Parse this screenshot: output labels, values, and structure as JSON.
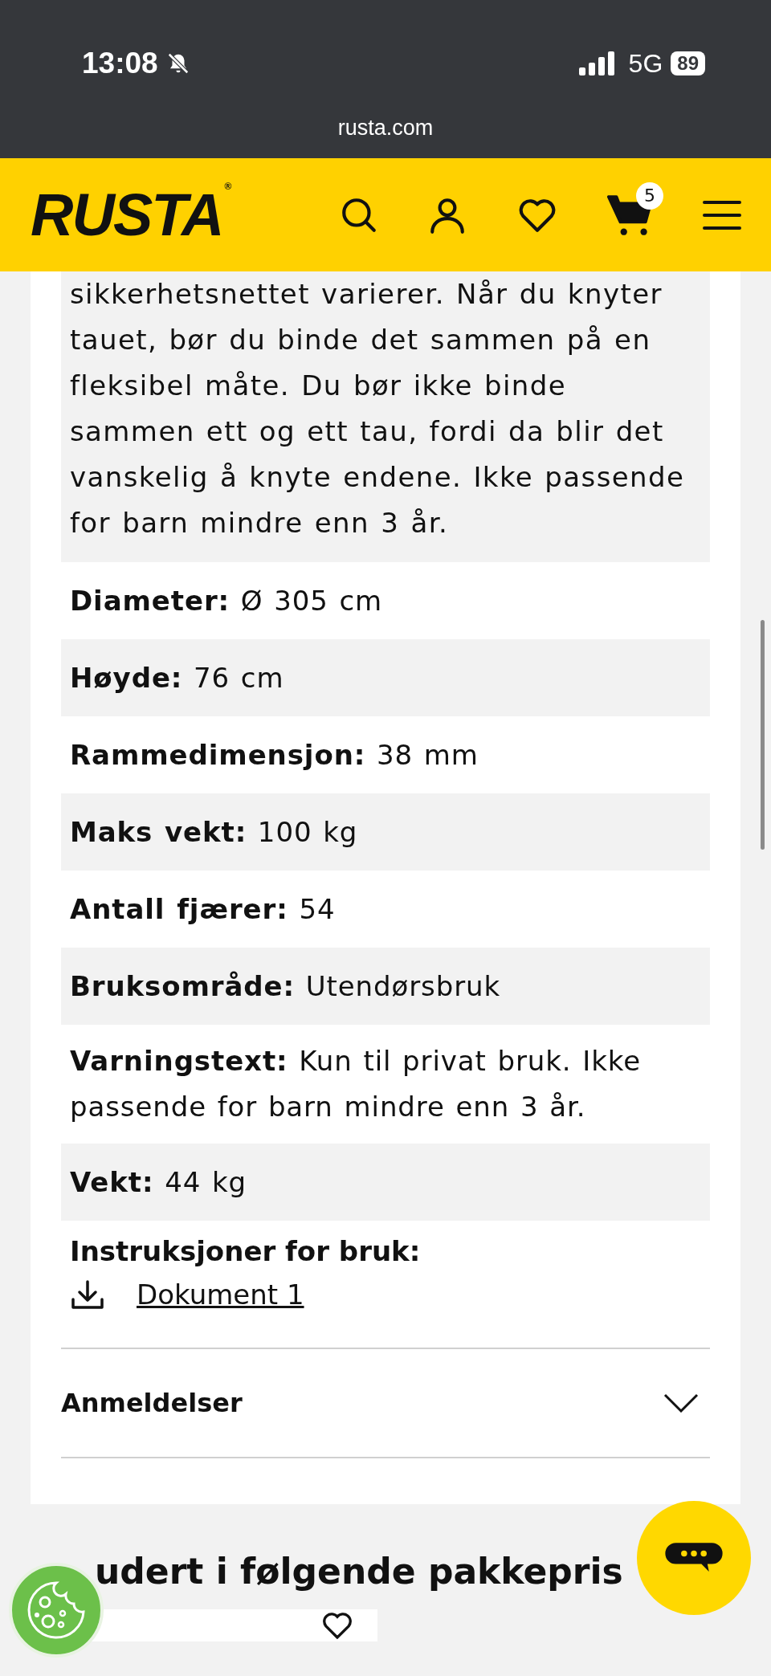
{
  "status_bar": {
    "time": "13:08",
    "network": "5G",
    "battery": "89"
  },
  "url": "rusta.com",
  "header": {
    "logo": "RUSTA",
    "logo_mark": "®",
    "cart_count": "5"
  },
  "description": "sikkerhetsnettet varierer. Når du knyter tauet, bør du binde det sammen på en fleksibel måte. Du bør ikke binde sammen ett og ett tau, fordi da blir det vanskelig å knyte endene. Ikke passende for barn mindre enn 3 år.",
  "specs": [
    {
      "label": "Diameter:",
      "value": "Ø 305 cm"
    },
    {
      "label": "Høyde:",
      "value": "76 cm"
    },
    {
      "label": "Rammedimensjon:",
      "value": "38 mm"
    },
    {
      "label": "Maks vekt:",
      "value": "100 kg"
    },
    {
      "label": "Antall fjærer:",
      "value": "54"
    },
    {
      "label": "Bruksområde:",
      "value": "Utendørsbruk"
    },
    {
      "label": "Varningstext:",
      "value": "Kun til privat bruk. Ikke passende for barn mindre enn 3 år."
    },
    {
      "label": "Vekt:",
      "value": "44 kg"
    }
  ],
  "instructions": {
    "label": "Instruksjoner for bruk:",
    "documents": [
      "Dokument 1"
    ]
  },
  "reviews": {
    "title": "Anmeldelser",
    "expanded": false
  },
  "bundle_heading": "udert i følgende pakkepris"
}
